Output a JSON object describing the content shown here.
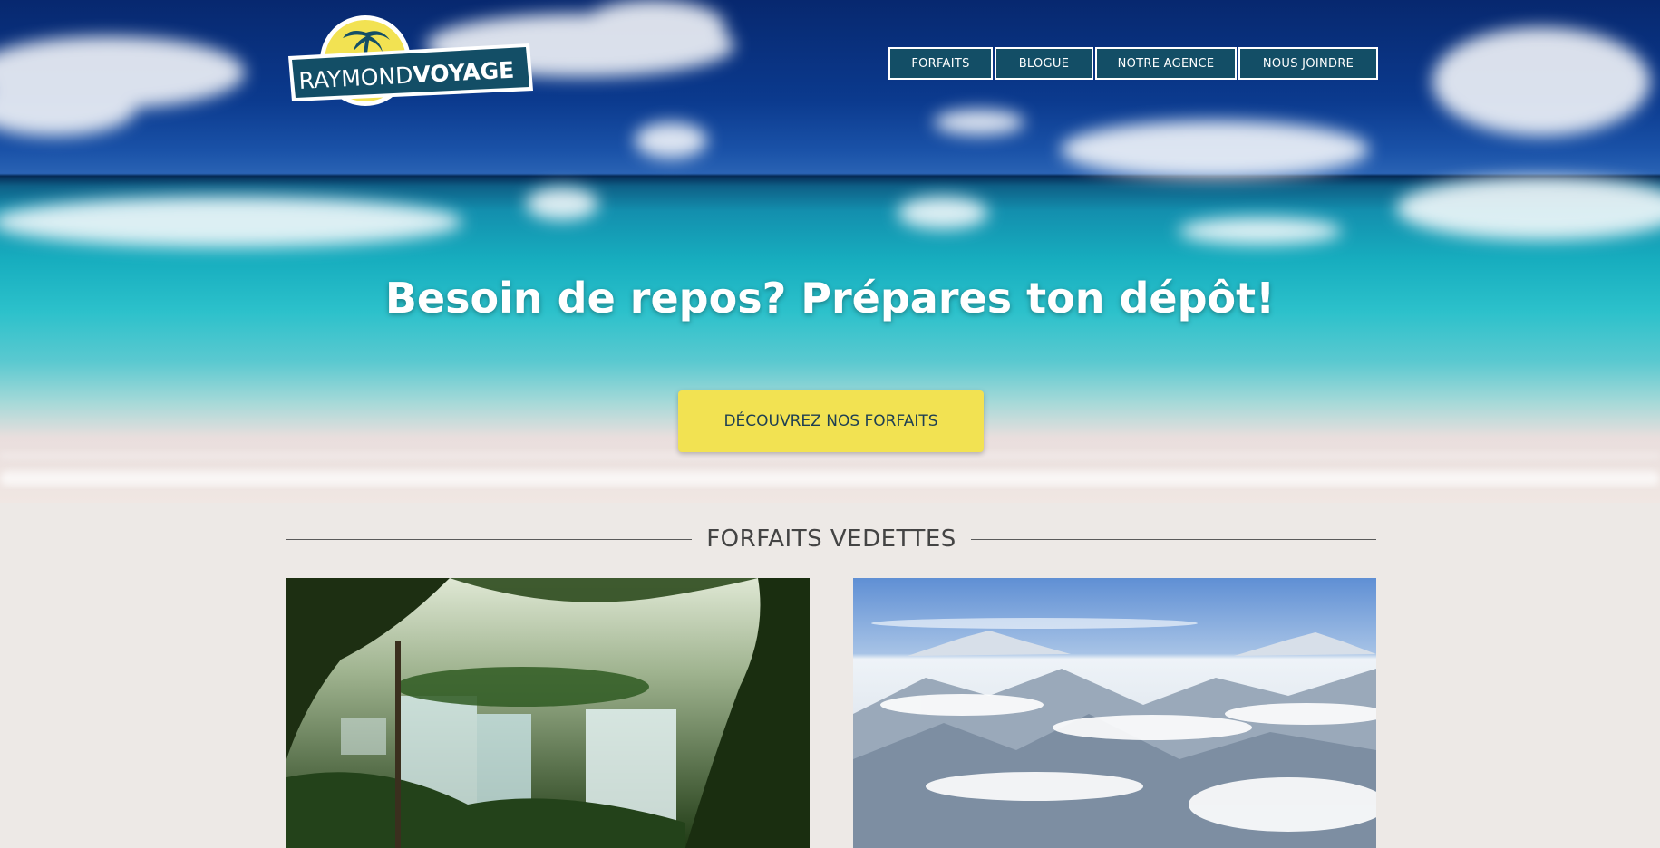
{
  "brand": {
    "name_part1": "RAYMOND",
    "name_part2": "VOYAGE",
    "logo_icon": "palm-tree-island-icon",
    "colors": {
      "primary": "#134e66",
      "accent": "#f2e252"
    }
  },
  "nav": {
    "items": [
      {
        "label": "FORFAITS"
      },
      {
        "label": "BLOGUE"
      },
      {
        "label": "NOTRE AGENCE"
      },
      {
        "label": "NOUS JOINDRE"
      }
    ]
  },
  "hero": {
    "title": "Besoin de repos? Prépares ton dépôt!",
    "cta_label": "DÉCOUVREZ NOS FORFAITS"
  },
  "featured": {
    "heading": "FORFAITS VEDETTES",
    "cards": [
      {
        "image": "jungle-waterfall-photo"
      },
      {
        "image": "snowy-mountains-photo"
      }
    ]
  }
}
